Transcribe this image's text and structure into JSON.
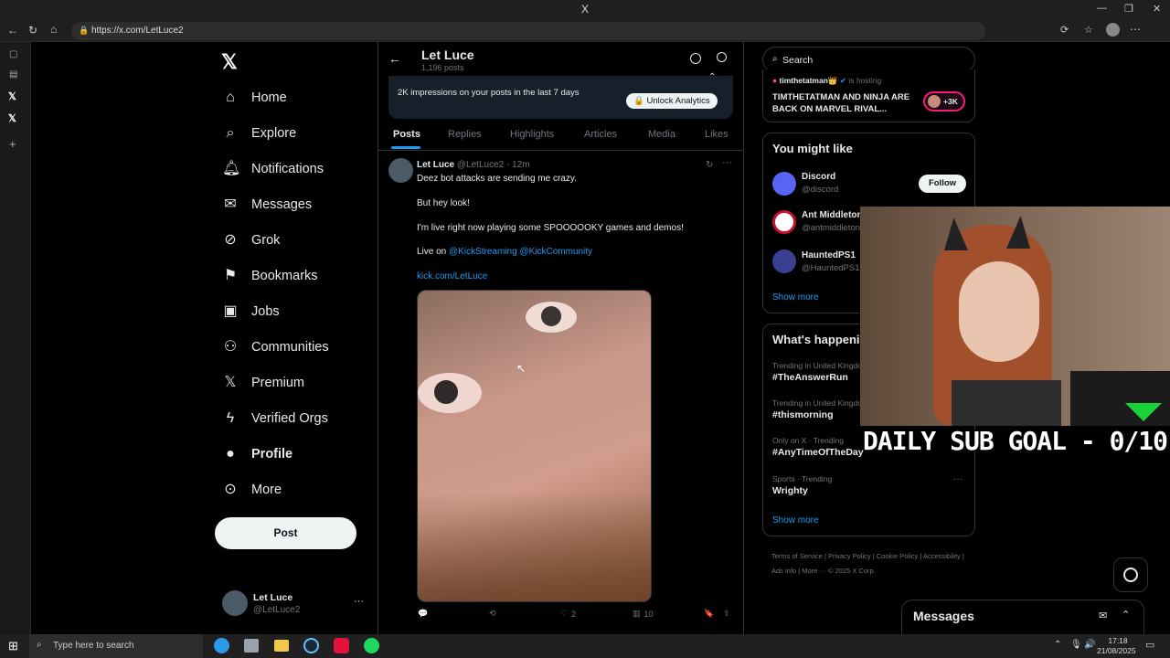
{
  "browser": {
    "window_title": "X",
    "url": "https://x.com/LetLuce2"
  },
  "nav": {
    "items": [
      {
        "label": "Home",
        "icon": "home-icon"
      },
      {
        "label": "Explore",
        "icon": "search-icon"
      },
      {
        "label": "Notifications",
        "icon": "bell-icon"
      },
      {
        "label": "Messages",
        "icon": "mail-icon"
      },
      {
        "label": "Grok",
        "icon": "grok-icon"
      },
      {
        "label": "Bookmarks",
        "icon": "bookmark-icon"
      },
      {
        "label": "Jobs",
        "icon": "briefcase-icon"
      },
      {
        "label": "Communities",
        "icon": "people-icon"
      },
      {
        "label": "Premium",
        "icon": "x-logo-icon"
      },
      {
        "label": "Verified Orgs",
        "icon": "lightning-icon"
      },
      {
        "label": "Profile",
        "icon": "person-icon"
      },
      {
        "label": "More",
        "icon": "more-circle-icon"
      }
    ],
    "post_button": "Post",
    "account": {
      "name": "Let Luce",
      "handle": "@LetLuce2"
    }
  },
  "profile_header": {
    "name": "Let Luce",
    "posts_count": "1,196 posts"
  },
  "analytics_banner": {
    "text": "2K impressions on your posts in the last 7 days",
    "button": "Unlock Analytics"
  },
  "tabs": [
    "Posts",
    "Replies",
    "Highlights",
    "Articles",
    "Media",
    "Likes"
  ],
  "tweet": {
    "author": "Let Luce",
    "handle": "@LetLuce2",
    "time": "· 12m",
    "lines": [
      "Deez bot attacks are sending me crazy.",
      "But hey look!",
      "I'm live right now playing some SPOOOOOKY games and demos!"
    ],
    "live_prefix": "Live on",
    "mention1": "@KickStreaming",
    "mention2": "@KickCommunity",
    "link": "kick.com/LetLuce",
    "likes": "2",
    "views": "10"
  },
  "search": {
    "placeholder": "Search"
  },
  "live_card": {
    "host": "timthetatman👑",
    "hosting": "is hosting",
    "title": "TIMTHETATMAN AND NINJA ARE BACK ON MARVEL RIVAL...",
    "count": "+3K"
  },
  "might_like": {
    "title": "You might like",
    "users": [
      {
        "name": "Discord",
        "handle": "@discord"
      },
      {
        "name": "Ant Middleton",
        "handle": "@antmiddleton"
      },
      {
        "name": "HauntedPS1",
        "handle": "@HauntedPS1"
      }
    ],
    "follow": "Follow",
    "show_more": "Show more"
  },
  "happening": {
    "title": "What's happening",
    "trends": [
      {
        "sub": "Trending in United Kingdom",
        "title": "#TheAnswerRun"
      },
      {
        "sub": "Trending in United Kingdom",
        "title": "#thismorning"
      },
      {
        "sub": "Only on X · Trending",
        "title": "#AnyTimeOfTheDay"
      },
      {
        "sub": "Sports · Trending",
        "title": "Wrighty"
      }
    ],
    "show_more": "Show more"
  },
  "footer": {
    "links": [
      "Terms of Service",
      "Privacy Policy",
      "Cookie Policy",
      "Accessibility",
      "Ads info",
      "More ···",
      "© 2025 X Corp."
    ]
  },
  "messages_bar": {
    "label": "Messages"
  },
  "overlay": {
    "sub_goal": "DAILY SUB GOAL - 0/10"
  },
  "taskbar": {
    "search_placeholder": "Type here to search",
    "time": "17:18",
    "date": "21/08/2025"
  },
  "colors": {
    "accent": "#1d9bf0",
    "background": "#000000",
    "border": "#2f3336",
    "muted": "#71767b"
  }
}
